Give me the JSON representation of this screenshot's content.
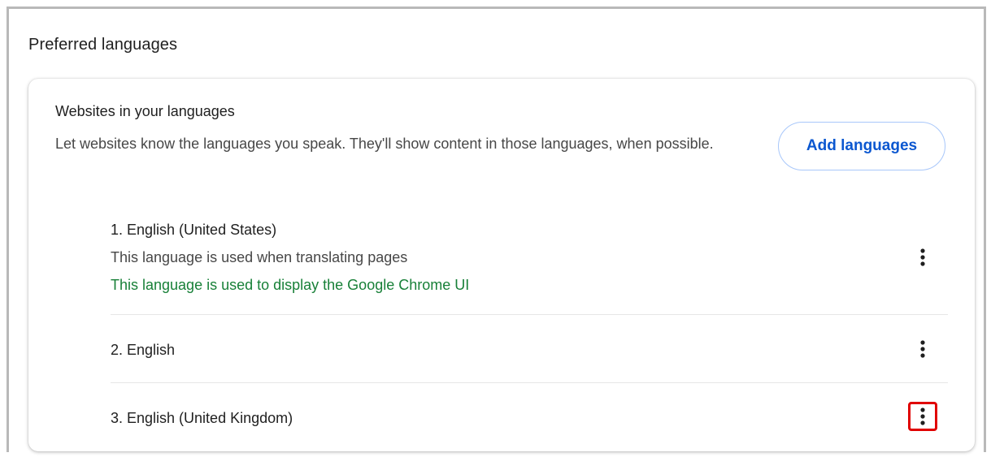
{
  "section": {
    "title": "Preferred languages"
  },
  "card": {
    "title": "Websites in your languages",
    "description": "Let websites know the languages you speak. They'll show content in those languages, when possible.",
    "add_button_label": "Add languages"
  },
  "languages": [
    {
      "label": "1. English (United States)",
      "note": "This language is used when translating pages",
      "ui_note": "This language is used to display the Google Chrome UI",
      "menu_icon": "more-vert-icon"
    },
    {
      "label": "2. English",
      "menu_icon": "more-vert-icon"
    },
    {
      "label": "3. English (United Kingdom)",
      "menu_icon": "more-vert-icon",
      "menu_highlighted": true
    }
  ],
  "colors": {
    "accent": "#0b57d0",
    "button_border": "#a8c7fa",
    "ui_note": "#188038",
    "highlight": "#e00000"
  }
}
